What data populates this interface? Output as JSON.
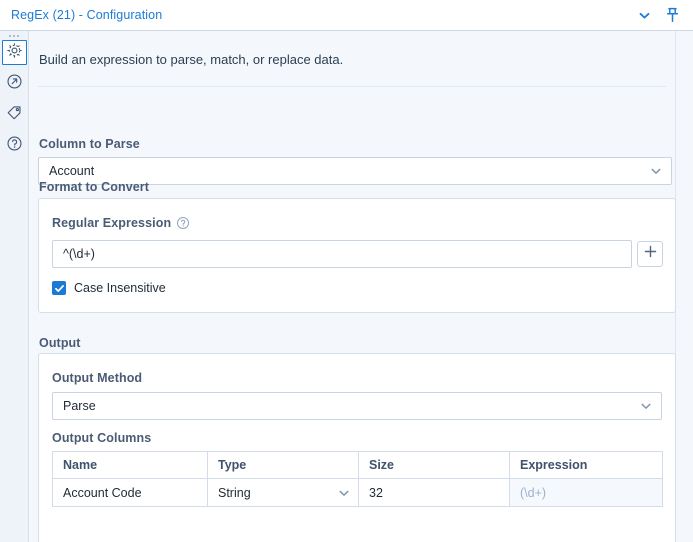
{
  "window": {
    "title": "RegEx (21) - Configuration",
    "collapse_icon": "chevron-down-icon",
    "pin_icon": "pin-icon"
  },
  "rail": {
    "items": [
      {
        "icon": "gear-icon",
        "name": "configuration",
        "selected": true
      },
      {
        "icon": "arrow-circle-icon",
        "name": "outputs",
        "selected": false
      },
      {
        "icon": "tag-icon",
        "name": "annotation",
        "selected": false
      },
      {
        "icon": "question-circle-icon",
        "name": "help",
        "selected": false
      }
    ]
  },
  "main": {
    "intro": "Build an expression to parse, match, or replace data.",
    "column_to_parse": {
      "label": "Column to Parse",
      "value": "Account",
      "chevron_icon": "chevron-down-icon"
    },
    "format_to_convert": {
      "label": "Format to Convert",
      "regex": {
        "label": "Regular Expression",
        "help_icon": "question-circle-icon",
        "value": "^(\\d+)",
        "add_icon": "plus-icon"
      },
      "case_insensitive": {
        "label": "Case Insensitive",
        "checked": true
      }
    },
    "output": {
      "label": "Output",
      "output_method": {
        "label": "Output Method",
        "value": "Parse",
        "chevron_icon": "chevron-down-icon"
      },
      "output_columns": {
        "label": "Output Columns",
        "headers": [
          "Name",
          "Type",
          "Size",
          "Expression"
        ],
        "rows": [
          {
            "name": "Account Code",
            "type": "String",
            "type_chevron_icon": "chevron-down-icon",
            "size": "32",
            "expression": "(\\d+)"
          }
        ]
      }
    }
  },
  "colors": {
    "accent": "#1c7cd6",
    "checkbox": "#1a7ad4",
    "page_background": "#f4f8fd",
    "card_background": "#ffffff",
    "label_text": "#4a5b74",
    "readonly_text": "#9fb2cc"
  }
}
